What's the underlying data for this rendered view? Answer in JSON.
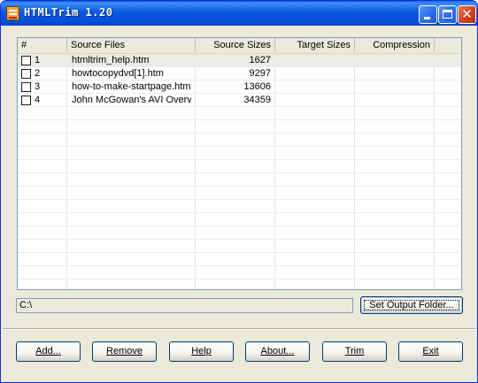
{
  "window": {
    "title": "HTMLTrim 1.20",
    "close_glyph": "✕"
  },
  "table": {
    "columns": [
      "#",
      "Source Files",
      "Source Sizes",
      "Target Sizes",
      "Compression"
    ],
    "rows": [
      {
        "index": "1",
        "file": "htmltrim_help.htm",
        "source_size": "1627",
        "target_size": "",
        "compression": ""
      },
      {
        "index": "2",
        "file": "howtocopydvd[1].htm",
        "source_size": "9297",
        "target_size": "",
        "compression": ""
      },
      {
        "index": "3",
        "file": "how-to-make-startpage.htm",
        "source_size": "13606",
        "target_size": "",
        "compression": ""
      },
      {
        "index": "4",
        "file": "John McGowan's AVI Overvi...",
        "source_size": "34359",
        "target_size": "",
        "compression": ""
      }
    ]
  },
  "output": {
    "path": "C:\\",
    "set_folder_label": "Set Output Folder..."
  },
  "buttons": {
    "add": "Add...",
    "remove": "Remove",
    "help": "Help",
    "about": "About...",
    "trim": "Trim",
    "exit": "Exit"
  },
  "colors": {
    "titlebar": "#0450d8",
    "face": "#ece9d8",
    "selected_row": "#ecebe4"
  }
}
